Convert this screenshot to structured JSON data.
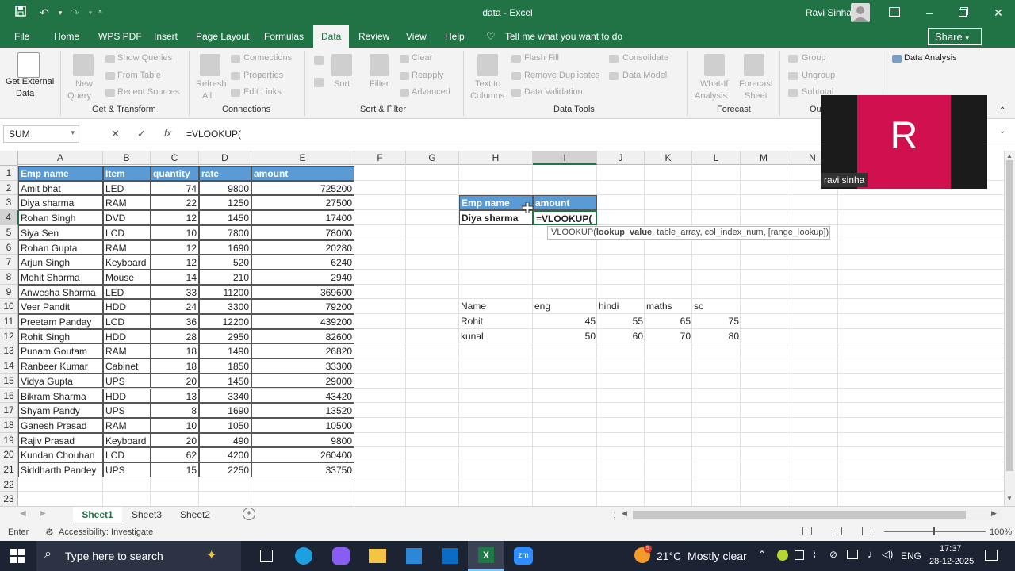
{
  "window": {
    "title": "data - Excel",
    "user": "Ravi Sinha",
    "share": "Share"
  },
  "menu": [
    "File",
    "Home",
    "WPS PDF",
    "Insert",
    "Page Layout",
    "Formulas",
    "Data",
    "Review",
    "View",
    "Help"
  ],
  "menu_active": "Data",
  "tell_me": "Tell me what you want to do",
  "ribbon": {
    "get_external": "Get External",
    "get_external2": "Data",
    "new_query": "New",
    "new_query2": "Query",
    "show_queries": "Show Queries",
    "from_table": "From Table",
    "recent_sources": "Recent Sources",
    "refresh": "Refresh",
    "refresh2": "All",
    "connections": "Connections",
    "properties": "Properties",
    "edit_links": "Edit Links",
    "sort": "Sort",
    "filter": "Filter",
    "clear": "Clear",
    "reapply": "Reapply",
    "advanced": "Advanced",
    "text_to_columns": "Text to",
    "text_to_columns2": "Columns",
    "flash_fill": "Flash Fill",
    "remove_duplicates": "Remove Duplicates",
    "data_validation": "Data Validation",
    "consolidate": "Consolidate",
    "data_model": "Data Model",
    "what_if": "What-If",
    "what_if2": "Analysis",
    "forecast_sheet": "Forecast",
    "forecast_sheet2": "Sheet",
    "group": "Group",
    "ungroup": "Ungroup",
    "subtotal": "Subtotal",
    "data_analysis": "Data Analysis",
    "groups": {
      "get_transform": "Get & Transform",
      "connections": "Connections",
      "sort_filter": "Sort & Filter",
      "data_tools": "Data Tools",
      "forecast": "Forecast",
      "outline": "Ou"
    }
  },
  "formula_bar": {
    "name_box": "SUM",
    "cancel": "✕",
    "enter": "✓",
    "fx": "fx",
    "formula": "=VLOOKUP("
  },
  "columns": [
    "A",
    "B",
    "C",
    "D",
    "E",
    "F",
    "G",
    "H",
    "I",
    "J",
    "K",
    "L",
    "M",
    "N"
  ],
  "rows": [
    "1",
    "2",
    "3",
    "4",
    "5",
    "6",
    "7",
    "8",
    "9",
    "10",
    "11",
    "12",
    "13",
    "14",
    "15",
    "16",
    "17",
    "18",
    "19",
    "20",
    "21",
    "22",
    "23"
  ],
  "table": {
    "headers": [
      "Emp  name",
      "Item",
      "quantity",
      "rate",
      "amount"
    ],
    "rows": [
      [
        "Amit bhat",
        "LED",
        "74",
        "9800",
        "725200"
      ],
      [
        "Diya sharma",
        "RAM",
        "22",
        "1250",
        "27500"
      ],
      [
        "Rohan Singh",
        "DVD",
        "12",
        "1450",
        "17400"
      ],
      [
        "Siya Sen",
        "LCD",
        "10",
        "7800",
        "78000"
      ],
      [
        "Rohan Gupta",
        "RAM",
        "12",
        "1690",
        "20280"
      ],
      [
        "Arjun Singh",
        "Keyboard",
        "12",
        "520",
        "6240"
      ],
      [
        "Mohit Sharma",
        "Mouse",
        "14",
        "210",
        "2940"
      ],
      [
        "Anwesha Sharma",
        "LED",
        "33",
        "11200",
        "369600"
      ],
      [
        "Veer Pandit",
        "HDD",
        "24",
        "3300",
        "79200"
      ],
      [
        "Preetam Panday",
        "LCD",
        "36",
        "12200",
        "439200"
      ],
      [
        "Rohit Singh",
        "HDD",
        "28",
        "2950",
        "82600"
      ],
      [
        "Punam Goutam",
        "RAM",
        "18",
        "1490",
        "26820"
      ],
      [
        "Ranbeer Kumar",
        "Cabinet",
        "18",
        "1850",
        "33300"
      ],
      [
        "Vidya Gupta",
        "UPS",
        "20",
        "1450",
        "29000"
      ],
      [
        "Bikram Sharma",
        "HDD",
        "13",
        "3340",
        "43420"
      ],
      [
        "Shyam Pandy",
        "UPS",
        "8",
        "1690",
        "13520"
      ],
      [
        "Ganesh Prasad",
        "RAM",
        "10",
        "1050",
        "10500"
      ],
      [
        "Rajiv Prasad",
        "Keyboard",
        "20",
        "490",
        "9800"
      ],
      [
        "Kundan Chouhan",
        "LCD",
        "62",
        "4200",
        "260400"
      ],
      [
        "Siddharth Pandey",
        "UPS",
        "15",
        "2250",
        "33750"
      ]
    ]
  },
  "lookup": {
    "h_emp": "Emp name",
    "h_amount": "amount",
    "emp_value": "Diya sharma",
    "formula": "=VLOOKUP("
  },
  "tooltip": {
    "func": "VLOOKUP(",
    "arg1": "lookup_value",
    "rest": ", table_array, col_index_num, [range_lookup])"
  },
  "marks": {
    "headers": [
      "Name",
      "eng",
      "hindi",
      "maths",
      "sc"
    ],
    "rows": [
      [
        "Rohit",
        "45",
        "55",
        "65",
        "75"
      ],
      [
        "kunal",
        "50",
        "60",
        "70",
        "80"
      ]
    ]
  },
  "sheets": [
    "Sheet1",
    "Sheet3",
    "Sheet2"
  ],
  "active_sheet": "Sheet1",
  "status": {
    "mode": "Enter",
    "accessibility": "Accessibility: Investigate",
    "zoom": "100%"
  },
  "video": {
    "initial": "R",
    "name": "ravi sinha"
  },
  "taskbar": {
    "search": "Type here to search",
    "weather": "21°C  Mostly clear",
    "weather_badge": "5",
    "lang": "ENG",
    "time": "17:37",
    "date": "28-12-2025"
  },
  "colors": {
    "excel_green": "#217346",
    "table_header": "#5b9bd5",
    "selection": "#217346",
    "video_tile": "#d1104f"
  }
}
